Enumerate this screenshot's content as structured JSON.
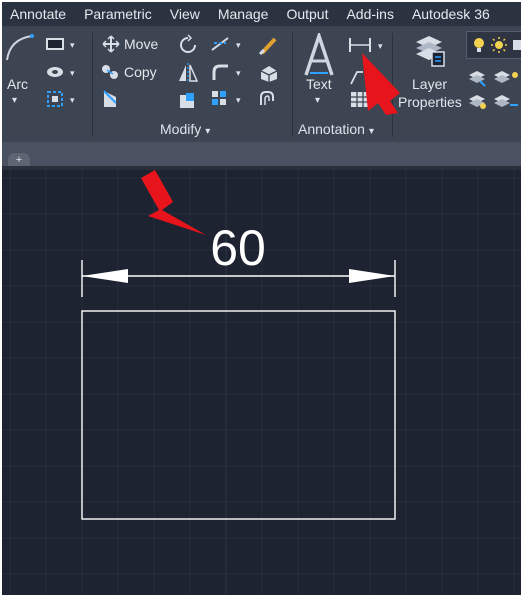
{
  "menubar": {
    "items": [
      "Annotate",
      "Parametric",
      "View",
      "Manage",
      "Output",
      "Add-ins",
      "Autodesk 36"
    ]
  },
  "ribbon": {
    "draw": {
      "arc_label": "Arc"
    },
    "modify": {
      "title": "Modify",
      "move_label": "Move",
      "copy_label": "Copy"
    },
    "annotation": {
      "title": "Annotation",
      "text_label": "Text"
    },
    "layers": {
      "layer_label": "Layer",
      "properties_label": "Properties"
    }
  },
  "tabstrip": {
    "plus": "+"
  },
  "drawing": {
    "dimension_text": "60",
    "colors": {
      "background": "#1d2330",
      "grid": "#2b3342",
      "lines": "#ffffff",
      "callout": "#e8141b"
    }
  }
}
